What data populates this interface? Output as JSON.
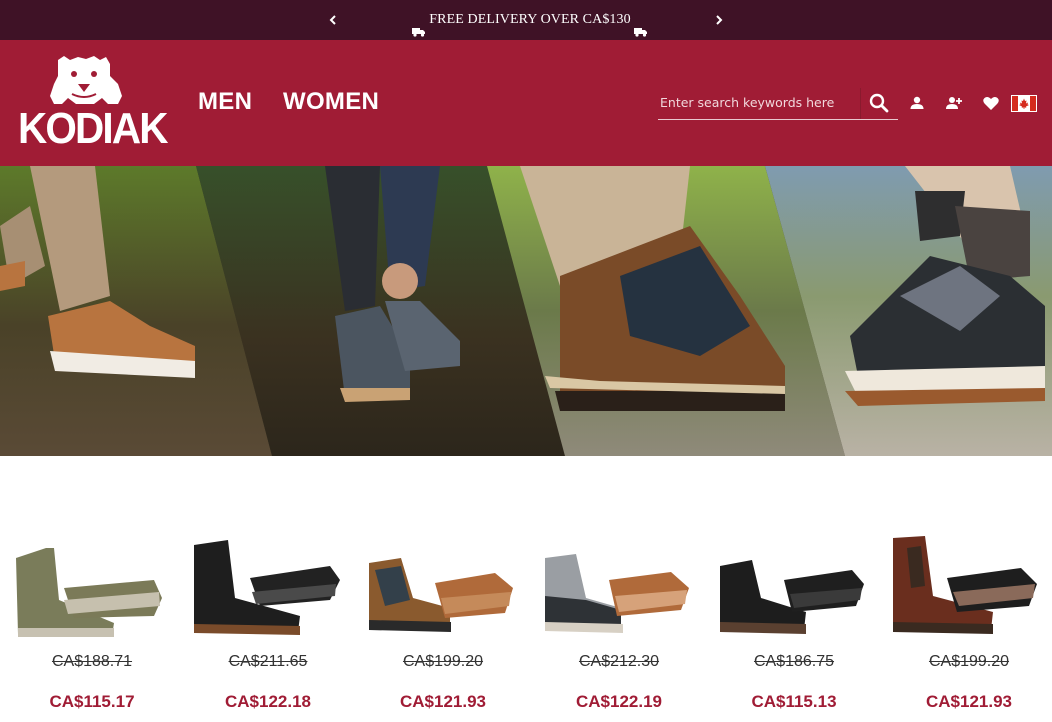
{
  "promo": {
    "prev_icon": "chevron-left-icon",
    "next_icon": "chevron-right-icon",
    "message": "FREE DELIVERY OVER CA$130",
    "truck_icon": "truck-icon"
  },
  "header": {
    "brand": "KODIAK",
    "registered": "®",
    "nav": {
      "men": "MEN",
      "women": "WOMEN"
    },
    "search": {
      "placeholder": "Enter search keywords here",
      "icon": "search-icon"
    },
    "icons": [
      "account-icon",
      "add-user-icon",
      "heart-icon",
      "canada-flag-icon"
    ],
    "colors": {
      "promo_bg": "#3f1226",
      "header_bg": "#a01c35",
      "price_sale": "#a01c35"
    }
  },
  "products": [
    {
      "old_price": "CA$188.71",
      "new_price": "CA$115.17"
    },
    {
      "old_price": "CA$211.65",
      "new_price": "CA$122.18"
    },
    {
      "old_price": "CA$199.20",
      "new_price": "CA$121.93"
    },
    {
      "old_price": "CA$212.30",
      "new_price": "CA$122.19"
    },
    {
      "old_price": "CA$186.75",
      "new_price": "CA$115.13"
    },
    {
      "old_price": "CA$199.20",
      "new_price": "CA$121.93"
    }
  ]
}
